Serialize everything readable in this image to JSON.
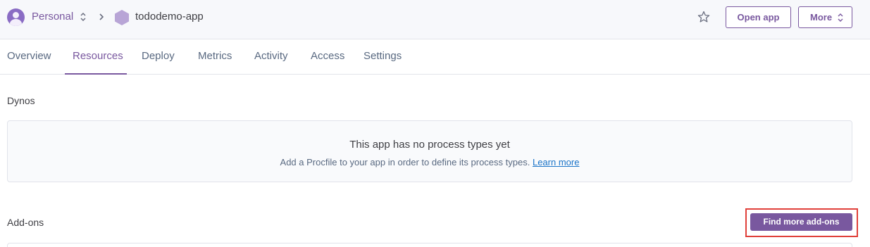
{
  "header": {
    "team_name": "Personal",
    "app_name": "tododemo-app",
    "open_app_label": "Open app",
    "more_label": "More"
  },
  "tabs": [
    {
      "label": "Overview"
    },
    {
      "label": "Resources",
      "active": true
    },
    {
      "label": "Deploy"
    },
    {
      "label": "Metrics"
    },
    {
      "label": "Activity"
    },
    {
      "label": "Access"
    },
    {
      "label": "Settings"
    }
  ],
  "dynos": {
    "title": "Dynos",
    "empty_heading": "This app has no process types yet",
    "empty_desc": "Add a Procfile to your app in order to define its process types.",
    "learn_more": "Learn more"
  },
  "addons": {
    "title": "Add-ons",
    "find_button": "Find more add-ons"
  },
  "colors": {
    "brand": "#79589f",
    "highlight": "#e0403a",
    "link": "#1a73c8"
  },
  "icons": [
    "user-avatar-icon",
    "updown-chevron-icon",
    "chevron-right-icon",
    "app-hexagon-icon",
    "star-icon"
  ]
}
